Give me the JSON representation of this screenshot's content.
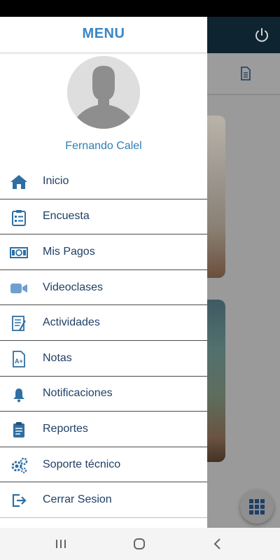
{
  "drawer": {
    "title": "MENU",
    "user_name": "Fernando Calel",
    "items": [
      {
        "label": "Inicio",
        "icon": "home-icon"
      },
      {
        "label": "Encuesta",
        "icon": "clipboard-list-icon"
      },
      {
        "label": "Mis Pagos",
        "icon": "money-bill-icon"
      },
      {
        "label": "Videoclases",
        "icon": "video-camera-icon"
      },
      {
        "label": "Actividades",
        "icon": "activity-list-icon"
      },
      {
        "label": "Notas",
        "icon": "grade-file-icon"
      },
      {
        "label": "Notificaciones",
        "icon": "bell-icon"
      },
      {
        "label": "Reportes",
        "icon": "clipboard-icon"
      },
      {
        "label": "Soporte técnico",
        "icon": "gears-icon"
      },
      {
        "label": "Cerrar Sesion",
        "icon": "sign-out-icon"
      }
    ]
  },
  "colors": {
    "accent": "#3a86c6",
    "menu_text": "#1f3f66",
    "icon": "#2f6fa3",
    "app_header": "#0e2430"
  },
  "background_app": {
    "header_icon": "power-icon",
    "subbar_icon": "document-icon",
    "fab_icon": "grid-icon"
  },
  "nav_bar": {
    "buttons": [
      "recent-apps-icon",
      "home-circle-icon",
      "back-icon"
    ]
  }
}
